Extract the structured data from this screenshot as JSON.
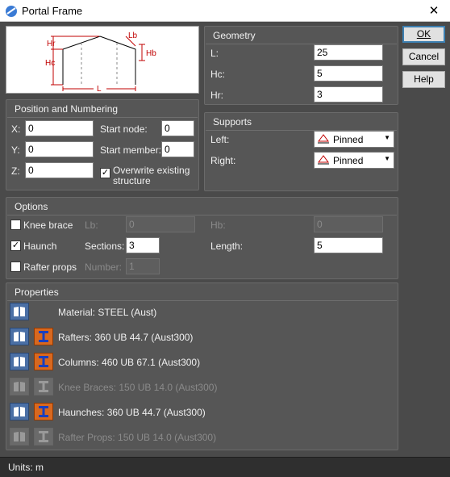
{
  "window": {
    "title": "Portal Frame",
    "close_glyph": "✕"
  },
  "diagram": {
    "labels": {
      "hr": "Hr",
      "hc": "Hc",
      "lb": "Lb",
      "hb": "Hb",
      "l": "L"
    }
  },
  "buttons": {
    "ok": "OK",
    "cancel": "Cancel",
    "help": "Help"
  },
  "geometry": {
    "title": "Geometry",
    "l_label": "L:",
    "l_value": "25",
    "hc_label": "Hc:",
    "hc_value": "5",
    "hr_label": "Hr:",
    "hr_value": "3"
  },
  "position": {
    "title": "Position and Numbering",
    "x_label": "X:",
    "x_value": "0",
    "y_label": "Y:",
    "y_value": "0",
    "z_label": "Z:",
    "z_value": "0",
    "start_node_label": "Start node:",
    "start_node_value": "0",
    "start_member_label": "Start member:",
    "start_member_value": "0",
    "overwrite_label_1": "Overwrite existing",
    "overwrite_label_2": "structure",
    "overwrite_checked": "✓"
  },
  "supports": {
    "title": "Supports",
    "left_label": "Left:",
    "left_value": "Pinned",
    "right_label": "Right:",
    "right_value": "Pinned",
    "arrow": "▼"
  },
  "options": {
    "title": "Options",
    "knee_brace_label": "Knee brace",
    "knee_brace_checked": "",
    "lb_label": "Lb:",
    "lb_value": "0",
    "hb_label": "Hb:",
    "hb_value": "0",
    "haunch_label": "Haunch",
    "haunch_checked": "✓",
    "sections_label": "Sections:",
    "sections_value": "3",
    "length_label": "Length:",
    "length_value": "5",
    "rafter_props_label": "Rafter props",
    "rafter_props_checked": "",
    "number_label": "Number:",
    "number_value": "1"
  },
  "properties": {
    "title": "Properties",
    "material": "Material: STEEL (Aust)",
    "rafters": "Rafters: 360 UB 44.7 (Aust300)",
    "columns": "Columns: 460 UB 67.1 (Aust300)",
    "knee_braces": "Knee Braces: 150 UB 14.0 (Aust300)",
    "haunches": "Haunches: 360 UB 44.7 (Aust300)",
    "rafter_props": "Rafter Props: 150 UB 14.0 (Aust300)"
  },
  "status": {
    "text": "Units: m"
  }
}
